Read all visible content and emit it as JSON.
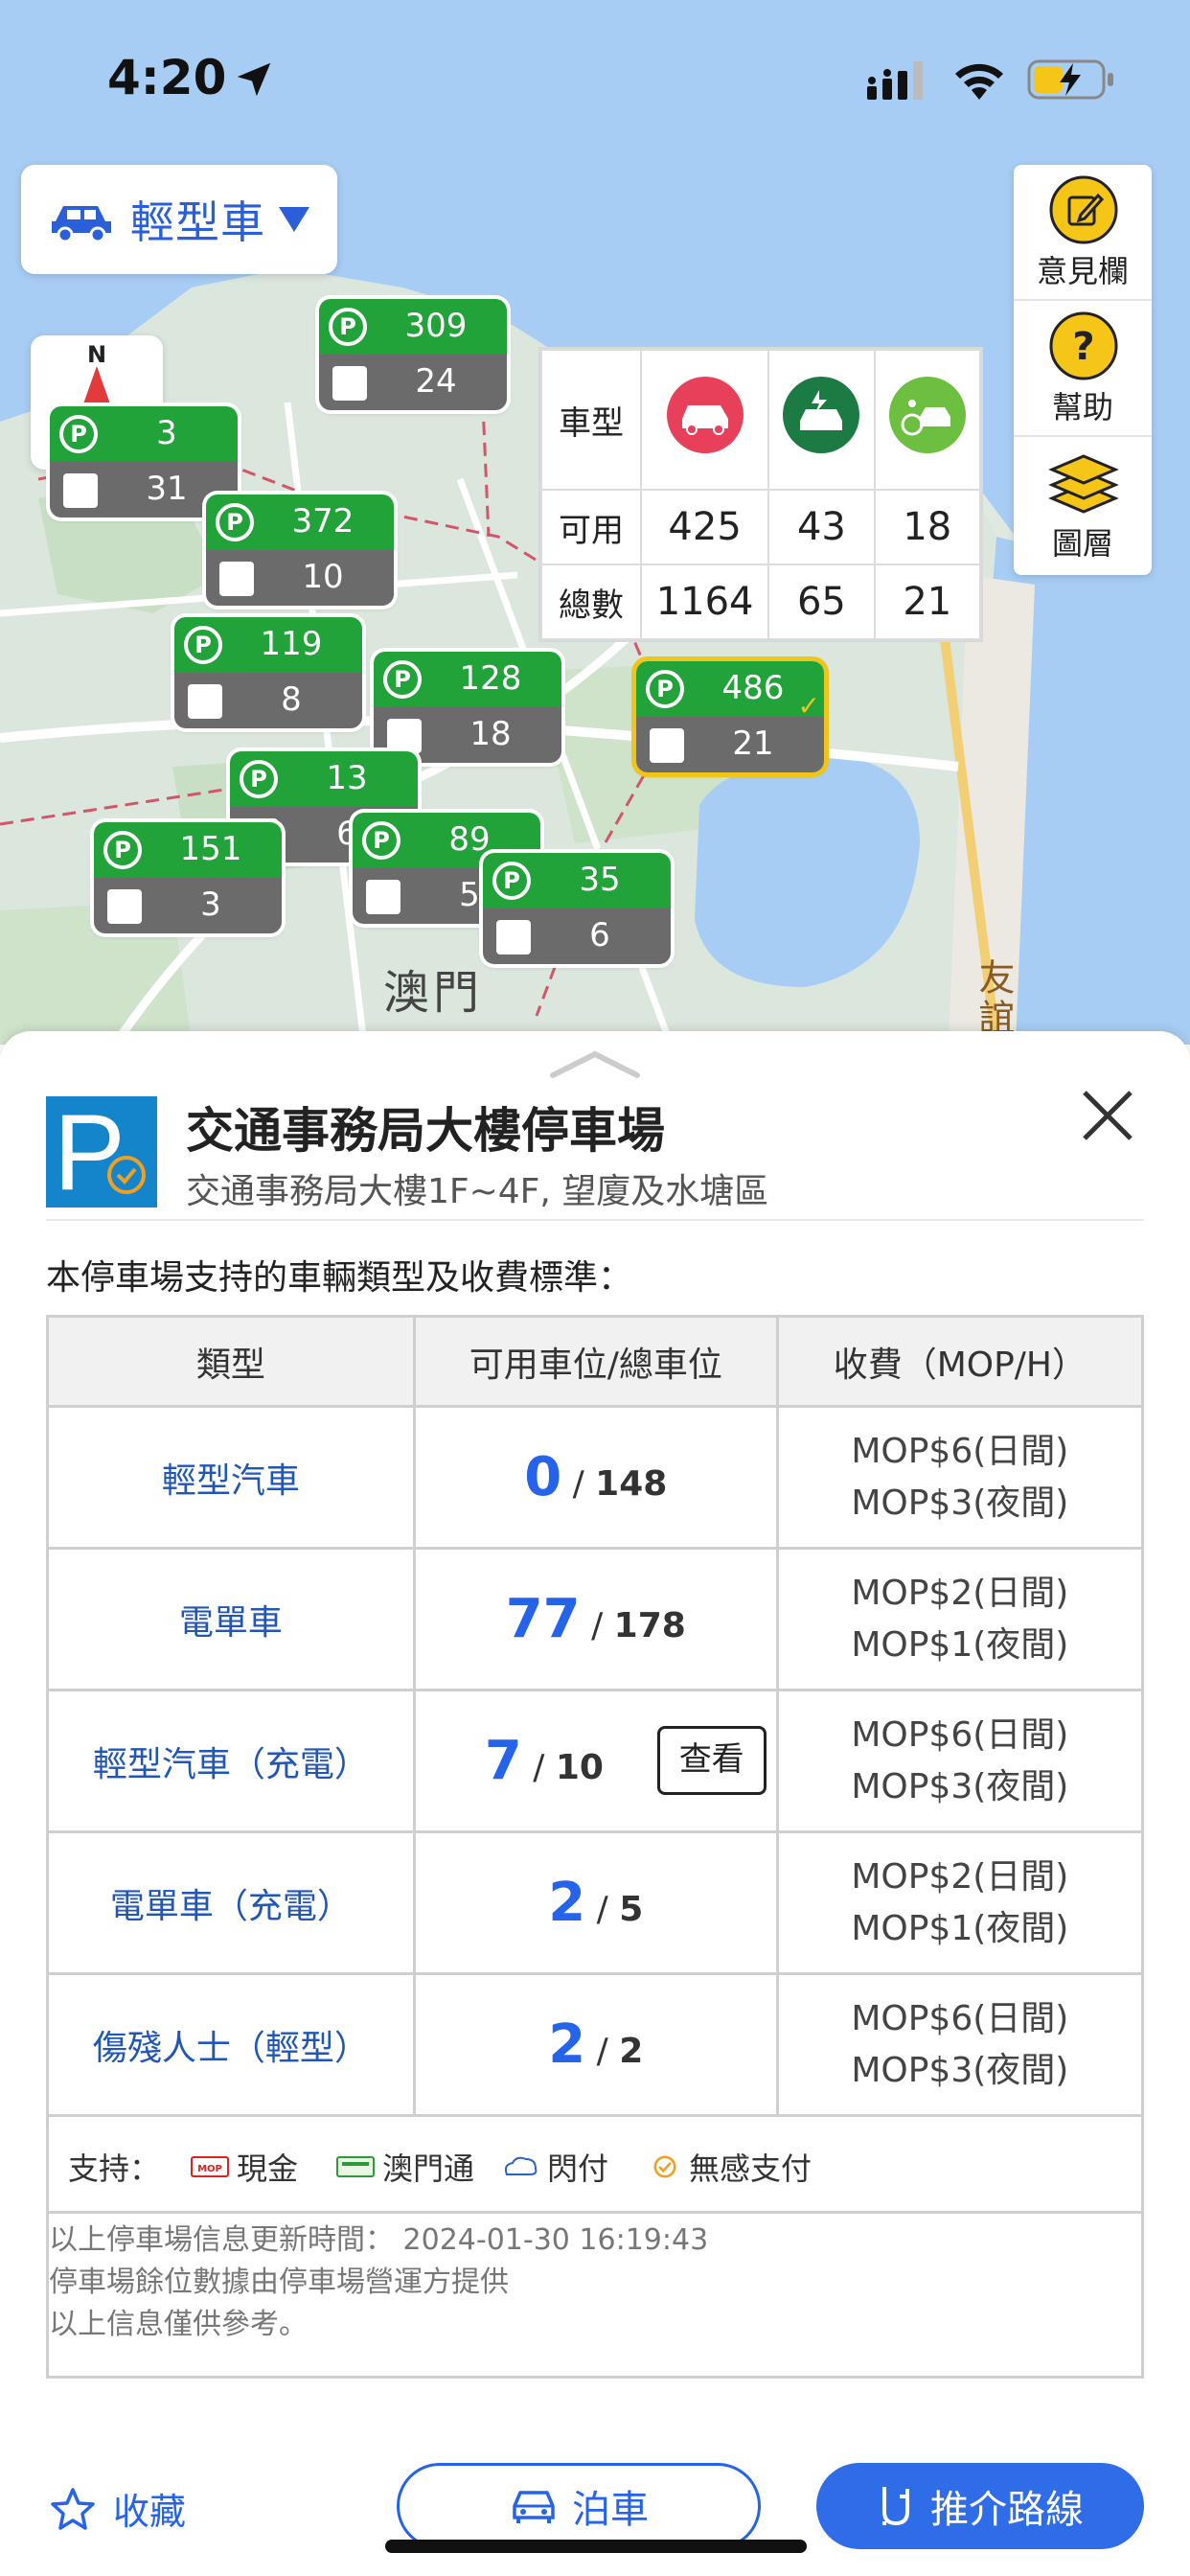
{
  "status_bar": {
    "time": "4:20"
  },
  "vehicle_selector": {
    "label": "輕型車",
    "icon": "car-icon"
  },
  "compass": {
    "label": "N"
  },
  "map_tools": [
    {
      "label": "意見欄",
      "icon": "edit-icon"
    },
    {
      "label": "幫助",
      "icon": "help-icon"
    },
    {
      "label": "圖層",
      "icon": "layers-icon"
    }
  ],
  "map_labels": {
    "city": "澳門",
    "road": "友誼"
  },
  "markers": [
    {
      "available": "309",
      "disabled": "24"
    },
    {
      "available": "3",
      "disabled": "31"
    },
    {
      "available": "372",
      "disabled": "10"
    },
    {
      "available": "119",
      "disabled": "8"
    },
    {
      "available": "128",
      "disabled": "18"
    },
    {
      "available": "486",
      "disabled": "21"
    },
    {
      "available": "13",
      "disabled": "6"
    },
    {
      "available": "151",
      "disabled": "3"
    },
    {
      "available": "89",
      "disabled": "5"
    },
    {
      "available": "35",
      "disabled": "6"
    }
  ],
  "summary": {
    "header": "車型",
    "rows": [
      {
        "label": "可用",
        "values": [
          "425",
          "43",
          "18"
        ]
      },
      {
        "label": "總數",
        "values": [
          "1164",
          "65",
          "21"
        ]
      }
    ],
    "colors": [
      "#e8405a",
      "#1c7a43",
      "#6cbf3f"
    ]
  },
  "carpark": {
    "name": "交通事務局大樓停車場",
    "address": "交通事務局大樓1F~4F, 望廈及水塘區",
    "intro": "本停車場支持的車輛類型及收費標準：",
    "columns": [
      "類型",
      "可用車位/總車位",
      "收費（MOP/H）"
    ],
    "rows": [
      {
        "type": "輕型汽車",
        "available": "0",
        "total": "148",
        "fee_day": "MOP$6(日間)",
        "fee_night": "MOP$3(夜間)"
      },
      {
        "type": "電單車",
        "available": "77",
        "total": "178",
        "fee_day": "MOP$2(日間)",
        "fee_night": "MOP$1(夜間)"
      },
      {
        "type": "輕型汽車（充電）",
        "available": "7",
        "total": "10",
        "fee_day": "MOP$6(日間)",
        "fee_night": "MOP$3(夜間)",
        "view_label": "查看"
      },
      {
        "type": "電單車（充電）",
        "available": "2",
        "total": "5",
        "fee_day": "MOP$2(日間)",
        "fee_night": "MOP$1(夜間)"
      },
      {
        "type": "傷殘人士（輕型）",
        "available": "2",
        "total": "2",
        "fee_day": "MOP$6(日間)",
        "fee_night": "MOP$3(夜間)"
      }
    ],
    "payments_label": "支持：",
    "payments": [
      "現金",
      "澳門通",
      "閃付",
      "無感支付"
    ],
    "info": [
      "以上停車場信息更新時間： 2024-01-30 16:19:43",
      "停車場餘位數據由停車場營運方提供",
      "以上信息僅供參考。"
    ]
  },
  "footer": {
    "favorite": "收藏",
    "park": "泊車",
    "route": "推介路線"
  },
  "colors": {
    "accent": "#2563eb",
    "marker_green": "#22a33a",
    "marker_gray": "#6b6b6b",
    "selected": "#f0c419"
  }
}
